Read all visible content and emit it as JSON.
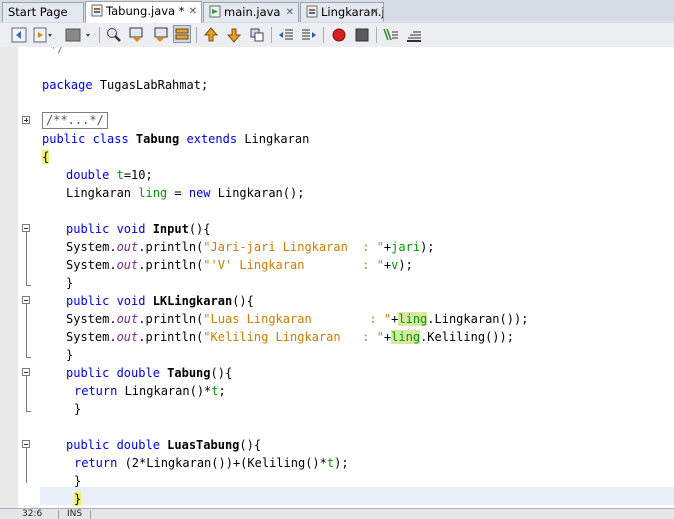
{
  "tabs": [
    {
      "label": "Start Page",
      "icon": "none",
      "active": false
    },
    {
      "label": "Tabung.java *",
      "icon": "java-file-icon",
      "active": true
    },
    {
      "label": "main.java",
      "icon": "java-file-icon",
      "active": false
    },
    {
      "label": "Lingkaran.java",
      "icon": "java-file-icon",
      "active": false
    }
  ],
  "toolbar": {
    "buttons": [
      "back",
      "forward",
      "history",
      "find",
      "find-previous",
      "find-next",
      "toggle-highlight",
      "previous-bookmark",
      "next-bookmark",
      "toggle-bookmark",
      "shift-left",
      "shift-right",
      "start-macro",
      "stop-macro",
      "comment",
      "uncomment"
    ]
  },
  "code": {
    "line_comment_end": "*/",
    "package_kw": "package",
    "package_name": "TugasLabRahmat;",
    "collapsed_javadoc": "/**...*/",
    "l_class_1": "public class ",
    "l_class_2": "Tabung",
    "l_class_3": " extends ",
    "l_class_4": "Lingkaran",
    "open_brace": "{",
    "l_double": "double ",
    "l_t": "t",
    "l_t_val": "=10;",
    "l_ling_type": "Lingkaran ",
    "l_ling_var": "ling",
    "l_ling_eq": " = ",
    "l_new": "new",
    "l_ling_ctor": " Lingkaran();",
    "m1_sig_kw": "public void ",
    "m1_name": "Input",
    "m1_rest": "(){",
    "sys": "System.",
    "out": "out",
    "println": ".println(",
    "m1_s1": "\"Jari-jari Lingkaran  : \"",
    "m1_s1_plus": "+",
    "m1_s1_var": "jari",
    "m1_s1_end": ");",
    "m1_s2": "\"'V' Lingkaran        : \"",
    "m1_s2_plus": "+",
    "m1_s2_var": "v",
    "m1_s2_end": ");",
    "close_brace": "}",
    "m2_sig_kw": "public void ",
    "m2_name": "LKLingkaran",
    "m2_rest": "(){",
    "m2_s1": "\"Luas Lingkaran        : \"",
    "m2_s1_plus": "+",
    "m2_s1_var": "ling",
    "m2_s1_end": ".Lingkaran());",
    "m2_s2": "\"Keliling Lingkaran   : \"",
    "m2_s2_plus": "+",
    "m2_s2_var": "ling",
    "m2_s2_end": ".Keliling());",
    "m3_sig_kw": "public double ",
    "m3_name": "Tabung",
    "m3_rest": "(){",
    "m3_ret_kw": "return",
    "m3_ret_1": " Lingkaran()*",
    "m3_ret_var": "t",
    "m3_ret_end": ";",
    "m4_sig_kw": "public double ",
    "m4_name": "LuasTabung",
    "m4_rest": "(){",
    "m4_ret_kw": "return",
    "m4_ret_1": " (2*Lingkaran())+(Keliling()*",
    "m4_ret_var": "t",
    "m4_ret_end": ");",
    "final_brace": "}"
  },
  "status": {
    "position": "32:6",
    "mode": "INS"
  },
  "colors": {
    "keyword": "#0000e6",
    "string": "#ce7b00",
    "field": "#009900",
    "static_field": "#7a2e82",
    "highlight": "#d7e8a3",
    "brace_match": "#f0f06a"
  }
}
